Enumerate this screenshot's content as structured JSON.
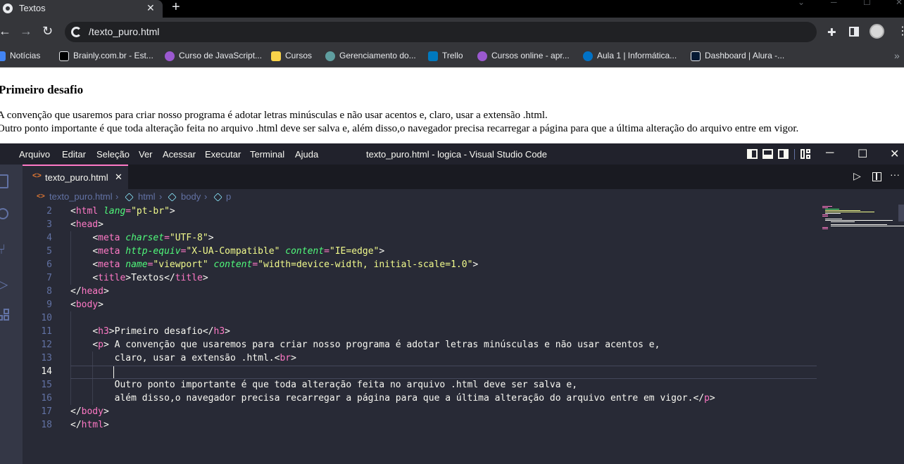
{
  "browser": {
    "tab_title": "Textos",
    "tab_close": "✕",
    "new_tab": "+",
    "back": "←",
    "forward": "→",
    "reload": "↻",
    "url": "/texto_puro.html",
    "extensions_icon": "puzzle-icon",
    "menu": "⋮",
    "bookmarks": [
      {
        "label": "Notícias",
        "color": "#4285f4"
      },
      {
        "label": "Brainly.com.br - Est...",
        "color": "#000000"
      },
      {
        "label": "Curso de JavaScript...",
        "color": "#9b59d0"
      },
      {
        "label": "Cursos",
        "color": "#f9d34a"
      },
      {
        "label": "Gerenciamento do...",
        "color": "#5f9ea0"
      },
      {
        "label": "Trello",
        "color": "#0079bf"
      },
      {
        "label": "Cursos online - apr...",
        "color": "#9b59d0"
      },
      {
        "label": "Aula 1 | Informática...",
        "color": "#0072c6"
      },
      {
        "label": "Dashboard | Alura -...",
        "color": "#051933"
      }
    ],
    "bookmarks_overflow": "»"
  },
  "webpage": {
    "heading": "Primeiro desafio",
    "paragraph_line1": "A convenção que usaremos para criar nosso programa é adotar letras minúsculas e não usar acentos e, claro, usar a extensão .html.",
    "paragraph_line2": "Outro ponto importante é que toda alteração feita no arquivo .html deve ser salva e, além disso,o navegador precisa recarregar a página para que a última alteração do arquivo entre em vigor."
  },
  "vscode": {
    "menu": [
      "Arquivo",
      "Editar",
      "Seleção",
      "Ver",
      "Acessar",
      "Executar",
      "Terminal",
      "Ajuda"
    ],
    "window_title": "texto_puro.html - logica - Visual Studio Code",
    "minimize": "─",
    "maximize": "☐",
    "close": "✕",
    "editor_tab": {
      "code_icon": "<>",
      "label": "texto_puro.html",
      "close": "✕"
    },
    "run": "▷",
    "more": "···",
    "breadcrumb": {
      "file": "texto_puro.html",
      "sep": "›",
      "items": [
        "html",
        "body",
        "p"
      ]
    },
    "current_line": 14,
    "lines": [
      {
        "n": "2"
      },
      {
        "n": "3"
      },
      {
        "n": "4"
      },
      {
        "n": "5"
      },
      {
        "n": "6"
      },
      {
        "n": "7"
      },
      {
        "n": "8"
      },
      {
        "n": "9"
      },
      {
        "n": "10"
      },
      {
        "n": "11"
      },
      {
        "n": "12"
      },
      {
        "n": "13"
      },
      {
        "n": "14"
      },
      {
        "n": "15"
      },
      {
        "n": "16"
      },
      {
        "n": "17"
      },
      {
        "n": "18"
      }
    ],
    "code": {
      "l2_open": "<",
      "l2_tag": "html",
      "l2_attr": "lang",
      "l2_eq": "=",
      "l2_val": "\"pt-br\"",
      "l2_close": ">",
      "l3_open": "<",
      "l3_tag": "head",
      "l3_close": ">",
      "l4_tag": "meta",
      "l4_attr": "charset",
      "l4_val": "\"UTF-8\"",
      "l5_tag": "meta",
      "l5_attr1": "http-equiv",
      "l5_val1": "\"X-UA-Compatible\"",
      "l5_attr2": "content",
      "l5_val2": "\"IE=edge\"",
      "l6_tag": "meta",
      "l6_attr1": "name",
      "l6_val1": "\"viewport\"",
      "l6_attr2": "content",
      "l6_val2": "\"width=device-width, initial-scale=1.0\"",
      "l7_tag": "title",
      "l7_text": "Textos",
      "l7_end": "title",
      "l8_tag": "head",
      "l9_tag": "body",
      "l11_tag": "h3",
      "l11_text": "Primeiro desafio",
      "l11_end": "h3",
      "l12_tag": "p",
      "l12_text": " A convenção que usaremos para criar nosso programa é adotar letras minúsculas e não usar acentos e,",
      "l13_text": "claro, usar a extensão .html.",
      "l13_tag": "br",
      "l15_text": "Outro ponto importante é que toda alteração feita no arquivo .html deve ser salva e,",
      "l16_text": "além disso,o navegador precisa recarregar a página para que a última alteração do arquivo entre em vigor.",
      "l16_end": "p",
      "l17_tag": "body",
      "l18_tag": "html"
    }
  }
}
